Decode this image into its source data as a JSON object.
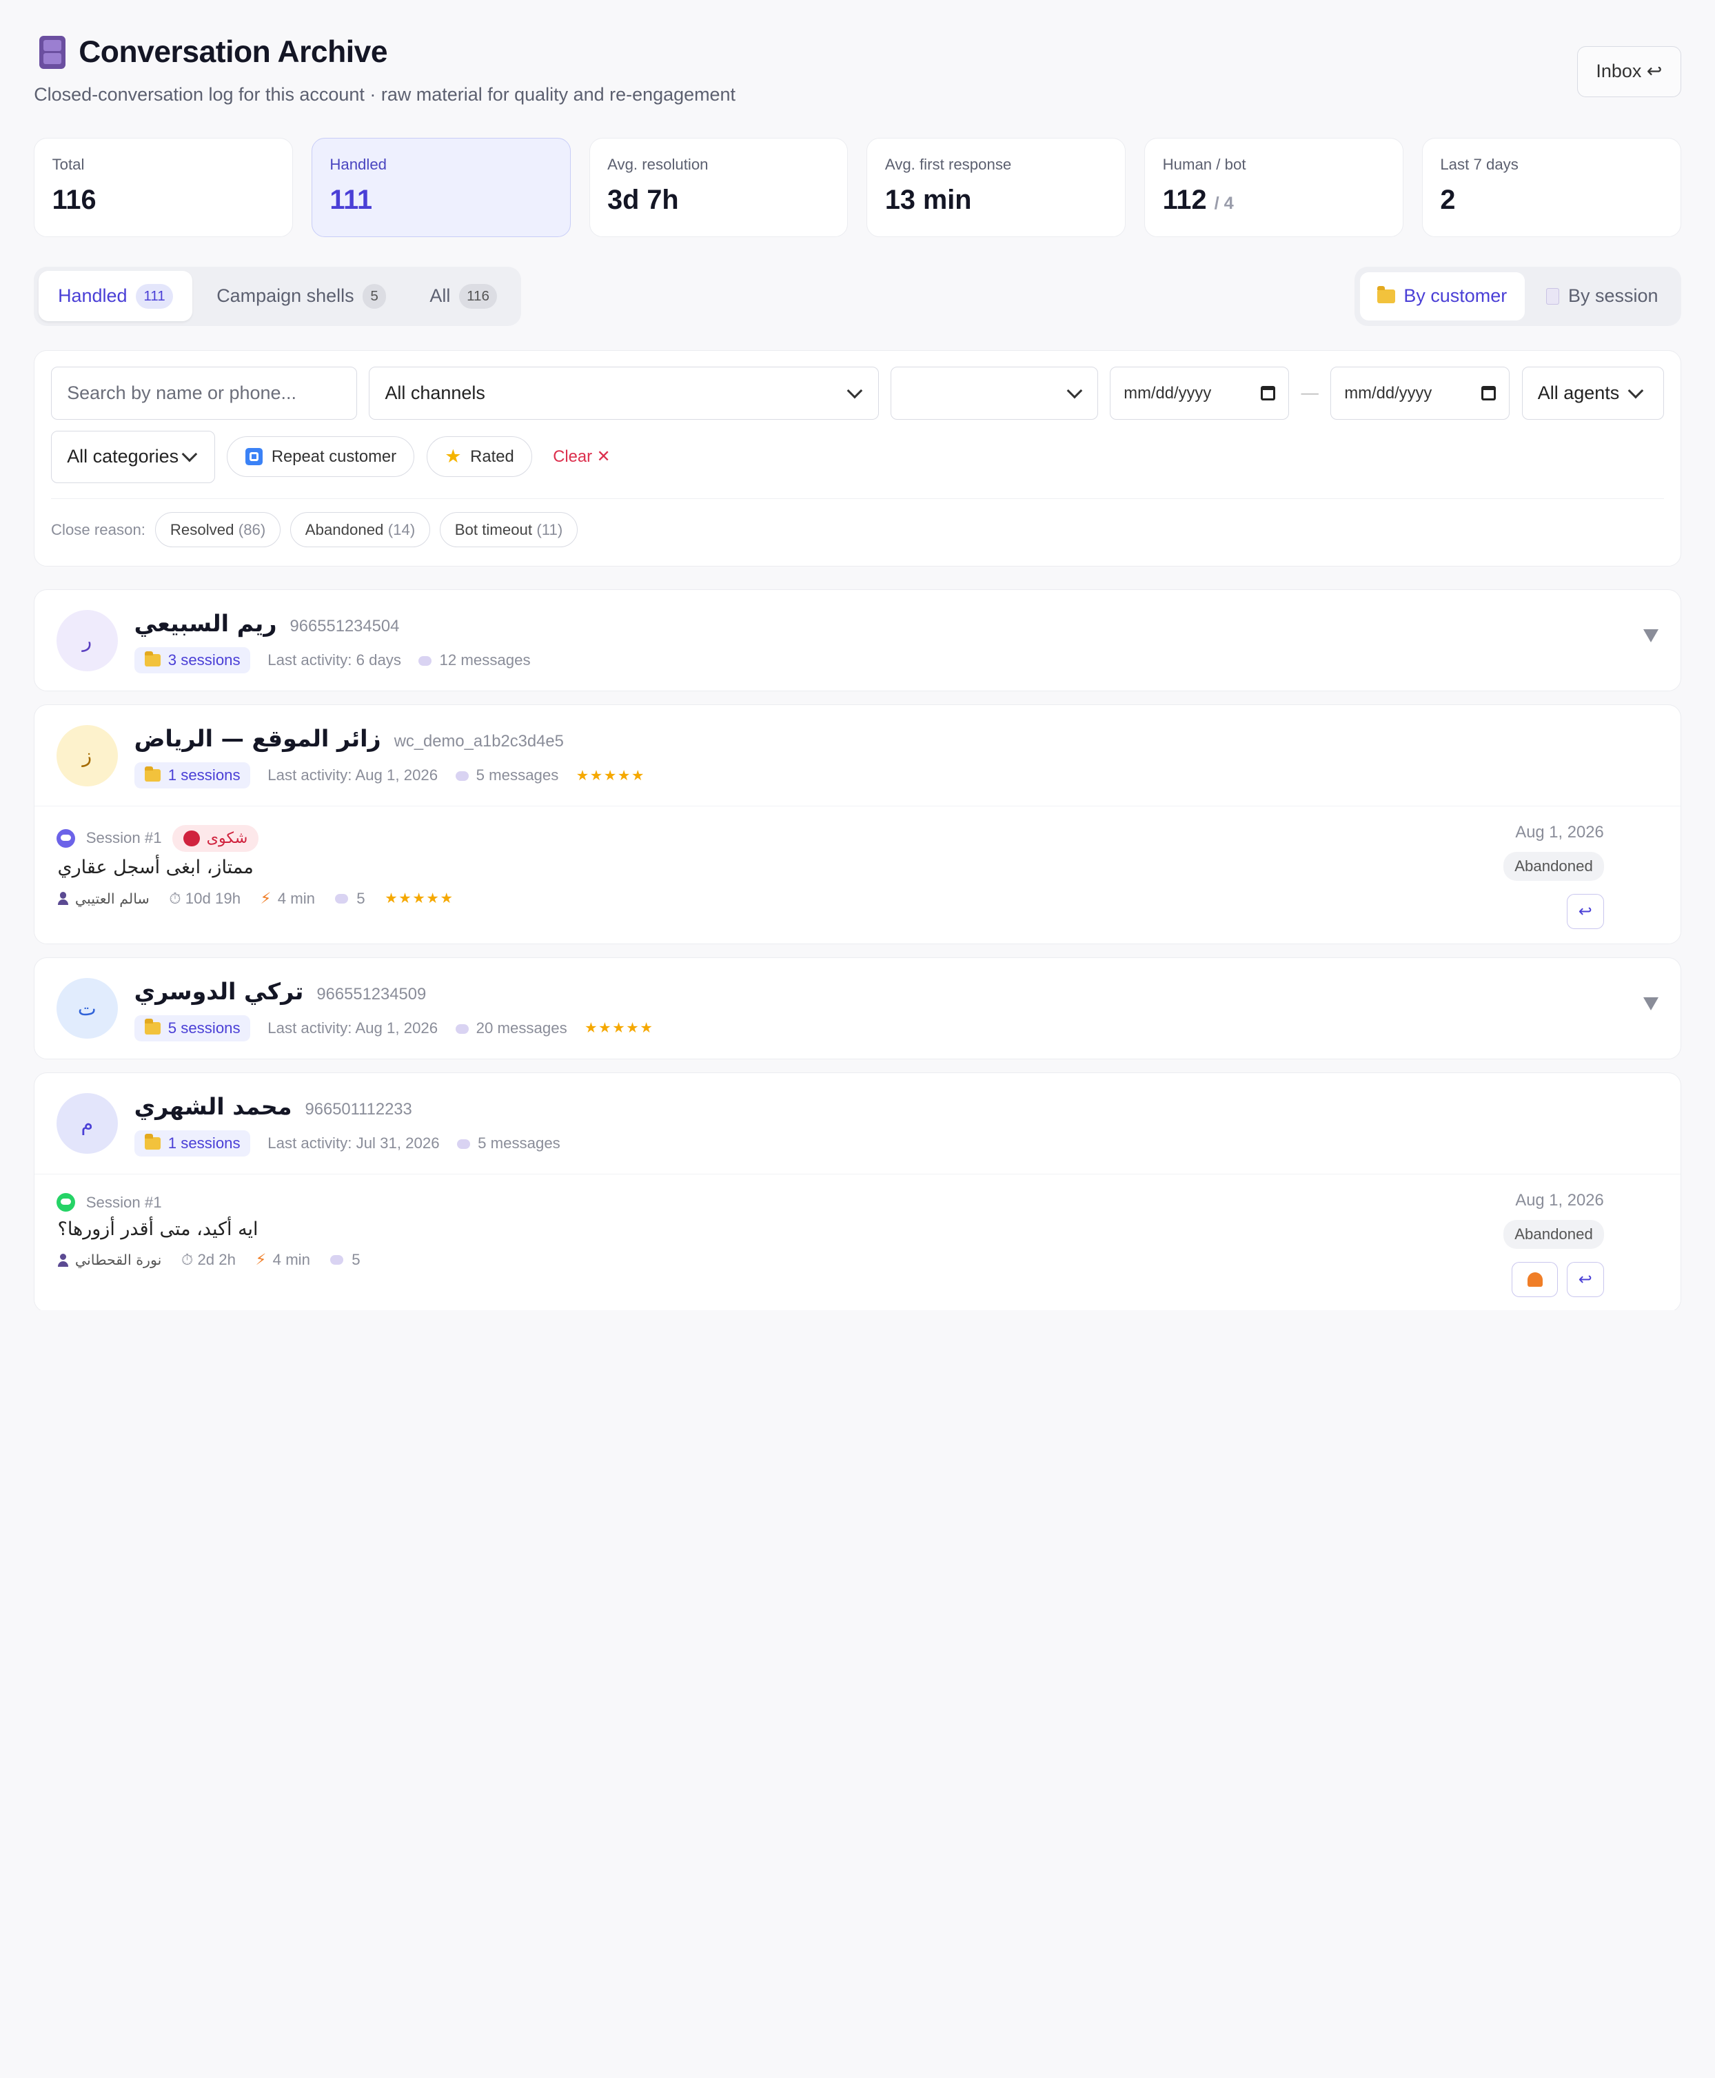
{
  "header": {
    "title": "Conversation Archive",
    "subtitle": "Closed-conversation log for this account · raw material for quality and re-engagement",
    "inbox_label": "Inbox ↩"
  },
  "stats": [
    {
      "label": "Total",
      "value": "116",
      "sub": ""
    },
    {
      "label": "Handled",
      "value": "111",
      "sub": ""
    },
    {
      "label": "Avg. resolution",
      "value": "3d 7h",
      "sub": ""
    },
    {
      "label": "Avg. first response",
      "value": "13 min",
      "sub": ""
    },
    {
      "label": "Human / bot",
      "value": "112",
      "sub": "/ 4"
    },
    {
      "label": "Last 7 days",
      "value": "2",
      "sub": ""
    }
  ],
  "tabs": [
    {
      "label": "Handled",
      "count": "111"
    },
    {
      "label": "Campaign shells",
      "count": "5"
    },
    {
      "label": "All",
      "count": "116"
    }
  ],
  "view_toggle": {
    "by_customer": "By customer",
    "by_session": "By session"
  },
  "filters": {
    "search_placeholder": "Search by name or phone...",
    "channel": "All channels",
    "status": "",
    "date_from": "mm/dd/yyyy",
    "date_to": "mm/dd/yyyy",
    "agent": "All agents",
    "category": "All categories",
    "repeat_label": "Repeat customer",
    "rated_label": "Rated",
    "clear_label": "Clear ✕",
    "close_reason_label": "Close reason:",
    "close_reasons": [
      {
        "label": "Resolved",
        "count": "(86)"
      },
      {
        "label": "Abandoned",
        "count": "(14)"
      },
      {
        "label": "Bot timeout",
        "count": "(11)"
      }
    ]
  },
  "customers": [
    {
      "initial": "ر",
      "name": "ريم السبيعي",
      "id": "966551234504",
      "sessions": "3 sessions",
      "last_activity": "Last activity: 6 days",
      "messages": "12 messages",
      "stars": ""
    },
    {
      "initial": "ز",
      "name": "زائر الموقع — الرياض",
      "id": "wc_demo_a1b2c3d4e5",
      "sessions": "1 sessions",
      "last_activity": "Last activity: Aug 1, 2026",
      "messages": "5 messages",
      "stars": "★★★★★",
      "session": {
        "label": "Session #1",
        "category": "شكوى",
        "message": "ممتاز، ابغى أسجل عقاري",
        "agent": "سالم العتيبي",
        "duration": "⏱ 10d 19h",
        "first_response": "4 min",
        "msg_count": "5",
        "stars": "★★★★★",
        "date": "Aug 1, 2026",
        "status": "Abandoned"
      }
    },
    {
      "initial": "ت",
      "name": "تركي الدوسري",
      "id": "966551234509",
      "sessions": "5 sessions",
      "last_activity": "Last activity: Aug 1, 2026",
      "messages": "20 messages",
      "stars": "★★★★★"
    },
    {
      "initial": "م",
      "name": "محمد الشهري",
      "id": "966501112233",
      "sessions": "1 sessions",
      "last_activity": "Last activity: Jul 31, 2026",
      "messages": "5 messages",
      "stars": "",
      "session": {
        "label": "Session #1",
        "message": "ايه أكيد، متى أقدر أزورها؟",
        "agent": "نورة القحطاني",
        "duration": "⏱ 2d 2h",
        "first_response": "4 min",
        "msg_count": "5",
        "date": "Aug 1, 2026",
        "status": "Abandoned"
      }
    }
  ],
  "colors": {
    "accent": "#4a3fd6",
    "danger": "#dc2f4d",
    "star": "#f5a800",
    "whatsapp": "#25d366",
    "webchat": "#6c63e8"
  },
  "icons": {
    "title": "file-cabinet-icon",
    "reopen": "return-arrow-icon",
    "notify": "bell-icon"
  }
}
